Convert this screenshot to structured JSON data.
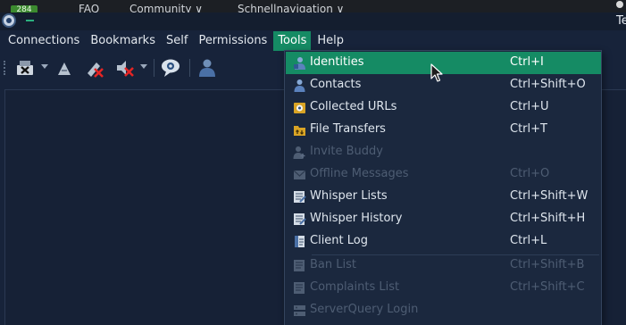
{
  "browser": {
    "badge": "284",
    "tabs": [
      "FAQ",
      "Community ∨",
      "Schnellnavigation ∨"
    ]
  },
  "window": {
    "title": "Te"
  },
  "menubar": {
    "items": [
      "Connections",
      "Bookmarks",
      "Self",
      "Permissions",
      "Tools",
      "Help"
    ],
    "active": "Tools"
  },
  "tools_menu": {
    "items": [
      {
        "label": "Identities",
        "shortcut": "Ctrl+I",
        "icon": "identities-icon",
        "state": "highlighted"
      },
      {
        "label": "Contacts",
        "shortcut": "Ctrl+Shift+O",
        "icon": "contacts-icon",
        "state": "enabled"
      },
      {
        "label": "Collected URLs",
        "shortcut": "Ctrl+U",
        "icon": "collected-urls-icon",
        "state": "enabled"
      },
      {
        "label": "File Transfers",
        "shortcut": "Ctrl+T",
        "icon": "file-transfers-icon",
        "state": "enabled"
      },
      {
        "label": "Invite Buddy",
        "shortcut": "",
        "icon": "invite-buddy-icon",
        "state": "disabled"
      },
      {
        "label": "Offline Messages",
        "shortcut": "Ctrl+O",
        "icon": "offline-messages-icon",
        "state": "disabled"
      },
      {
        "label": "Whisper Lists",
        "shortcut": "Ctrl+Shift+W",
        "icon": "whisper-lists-icon",
        "state": "enabled"
      },
      {
        "label": "Whisper History",
        "shortcut": "Ctrl+Shift+H",
        "icon": "whisper-history-icon",
        "state": "enabled"
      },
      {
        "label": "Client Log",
        "shortcut": "Ctrl+L",
        "icon": "client-log-icon",
        "state": "enabled"
      },
      {
        "label": "Ban List",
        "shortcut": "Ctrl+Shift+B",
        "icon": "ban-list-icon",
        "state": "disabled"
      },
      {
        "label": "Complaints List",
        "shortcut": "Ctrl+Shift+C",
        "icon": "complaints-list-icon",
        "state": "disabled"
      },
      {
        "label": "ServerQuery Login",
        "shortcut": "",
        "icon": "serverquery-login-icon",
        "state": "disabled"
      }
    ]
  },
  "colors": {
    "accent": "#158b64",
    "background": "#17233a",
    "menu_bg": "#1b283e",
    "disabled_text": "#4e5d73"
  }
}
